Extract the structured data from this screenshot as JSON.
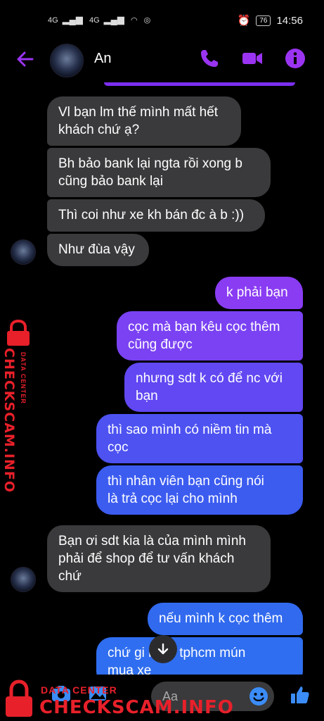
{
  "status_bar": {
    "signal_1": "4G",
    "signal_2": "4G",
    "battery": "76",
    "time": "14:56"
  },
  "header": {
    "contact_name": "An"
  },
  "messages": [
    {
      "side": "in",
      "text_lines": [
        "Vl bạn lm thế mình mất hết",
        "khách chứ ạ?"
      ]
    },
    {
      "side": "in",
      "text_lines": [
        "Bh bảo bank lại ngta rồi xong b",
        "cũng bảo bank lại"
      ]
    },
    {
      "side": "in",
      "text_lines": [
        "Thì coi như xe kh bán đc à b :))"
      ]
    },
    {
      "side": "in",
      "text_lines": [
        "Như đùa vậy"
      ]
    },
    {
      "side": "out",
      "text_lines": [
        "k phải bạn"
      ]
    },
    {
      "side": "out",
      "text_lines": [
        "cọc mà bạn kêu cọc thêm",
        "cũng được"
      ]
    },
    {
      "side": "out",
      "text_lines": [
        "nhưng sdt k có để nc với",
        "bạn"
      ]
    },
    {
      "side": "out",
      "text_lines": [
        "thì sao mình có niềm tin mà",
        "cọc"
      ]
    },
    {
      "side": "out",
      "text_lines": [
        "thì nhân viên  bạn cũng nói",
        "là trả cọc lại cho mình"
      ]
    },
    {
      "side": "in",
      "text_lines": [
        "Bạn ơi sdt kia là của mình mình",
        "phải để shop để tư vấn khách",
        "chứ"
      ]
    },
    {
      "side": "out",
      "text_lines": [
        "nếu mình k cọc thêm"
      ]
    },
    {
      "side": "out",
      "text_lines": [
        "chứ gi    nh ở tphcm mún",
        "mua xe"
      ]
    }
  ],
  "composer": {
    "placeholder": "Aa"
  },
  "watermark": {
    "side_label": "DATA CENTER",
    "side_brand": "CHECKSCAM.INFO",
    "bottom_label": "DATA CENTER",
    "bottom_brand": "CHECKSCAM.INFO"
  },
  "colors": {
    "accent": "#9b34f2",
    "incoming_bubble": "#3a3a3c",
    "outgoing_top": "#8a3cf3",
    "outgoing_bottom": "#2f6ef0",
    "watermark_red": "#e8202a"
  },
  "icons": [
    "back-arrow-icon",
    "phone-icon",
    "video-call-icon",
    "info-icon",
    "camera-icon",
    "image-icon",
    "emoji-icon",
    "thumbs-up-icon",
    "scroll-down-arrow-icon",
    "lock-icon"
  ]
}
